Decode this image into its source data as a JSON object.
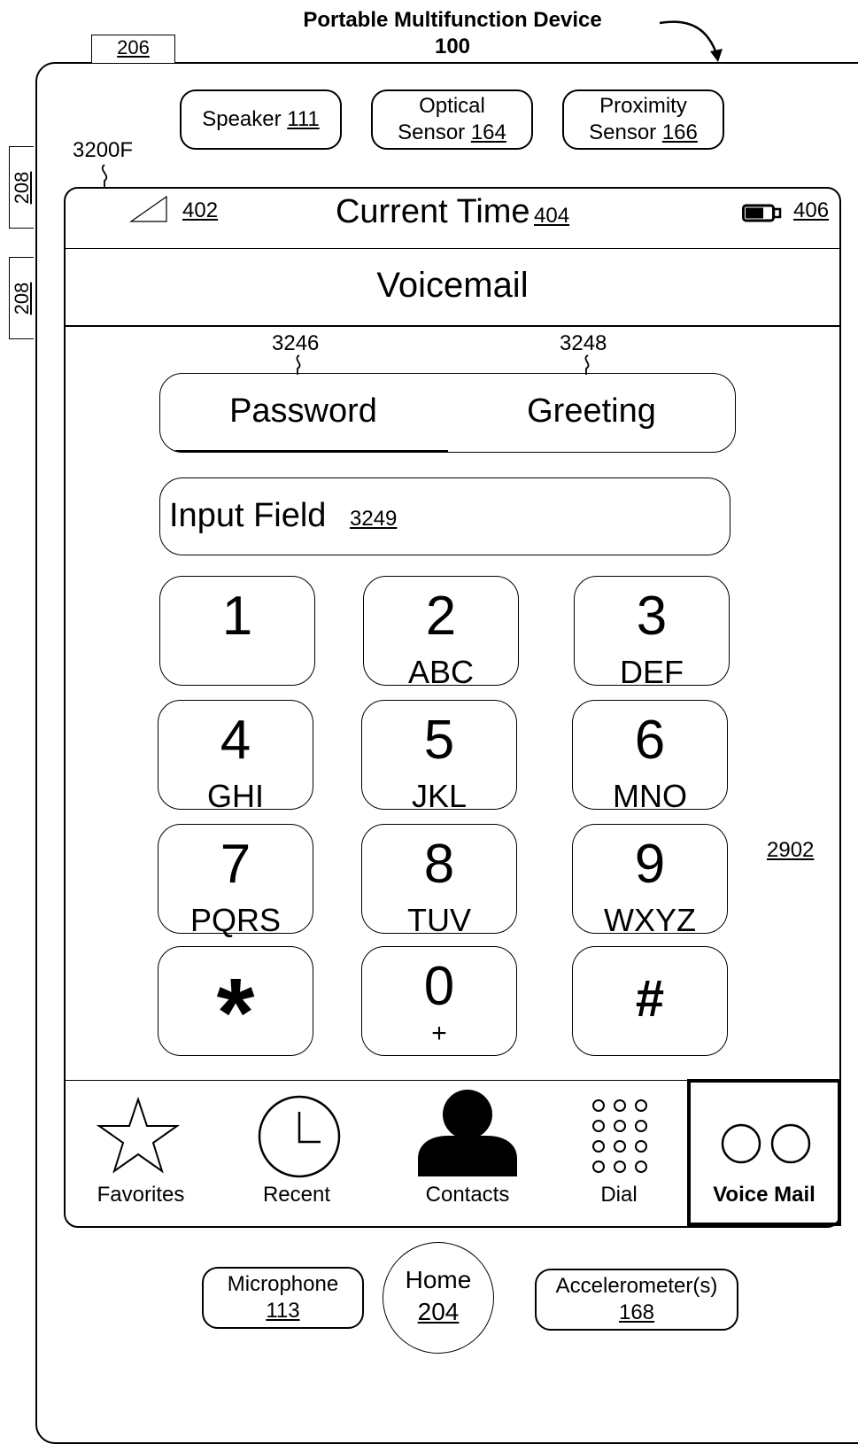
{
  "device": {
    "title": "Portable Multifunction Device",
    "ref": "100",
    "ref_206": "206",
    "ref_208_top": "208",
    "ref_208_bottom": "208"
  },
  "sensors": {
    "speaker_label": "Speaker",
    "speaker_ref": "111",
    "optical_label": "Optical",
    "optical_label2": "Sensor",
    "optical_ref": "164",
    "proximity_label": "Proximity",
    "proximity_label2": "Sensor",
    "proximity_ref": "166"
  },
  "screen": {
    "ref": "3200F"
  },
  "status_bar": {
    "signal_ref": "402",
    "time_label": "Current Time",
    "time_ref": "404",
    "battery_ref": "406"
  },
  "header": {
    "title": "Voicemail"
  },
  "segmented": {
    "password_ref": "3246",
    "greeting_ref": "3248",
    "password_label": "Password",
    "greeting_label": "Greeting"
  },
  "input_field": {
    "label": "Input Field",
    "ref": "3249"
  },
  "keypad": {
    "keys": [
      {
        "num": "1",
        "letters": ""
      },
      {
        "num": "2",
        "letters": "ABC"
      },
      {
        "num": "3",
        "letters": "DEF"
      },
      {
        "num": "4",
        "letters": "GHI"
      },
      {
        "num": "5",
        "letters": "JKL"
      },
      {
        "num": "6",
        "letters": "MNO"
      },
      {
        "num": "7",
        "letters": "PQRS"
      },
      {
        "num": "8",
        "letters": "TUV"
      },
      {
        "num": "9",
        "letters": "WXYZ"
      },
      {
        "num": "*",
        "letters": ""
      },
      {
        "num": "0",
        "letters": "+"
      },
      {
        "num": "#",
        "letters": ""
      }
    ],
    "ref": "2902"
  },
  "tab_bar": {
    "items": [
      {
        "label": "Favorites",
        "icon": "star-icon"
      },
      {
        "label": "Recent",
        "icon": "clock-icon"
      },
      {
        "label": "Contacts",
        "icon": "person-icon"
      },
      {
        "label": "Dial",
        "icon": "keypad-icon"
      },
      {
        "label": "Voice Mail",
        "icon": "voicemail-icon",
        "selected": true
      }
    ]
  },
  "hardware": {
    "microphone_label": "Microphone",
    "microphone_ref": "113",
    "home_label": "Home",
    "home_ref": "204",
    "accelerometer_label": "Accelerometer(s)",
    "accelerometer_ref": "168"
  }
}
